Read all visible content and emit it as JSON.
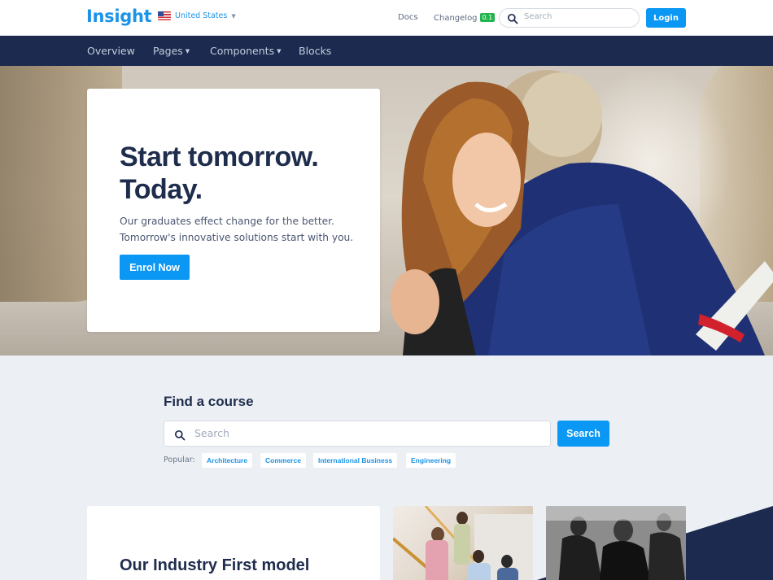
{
  "brand": {
    "logo": "Insight",
    "accent": "#1d93e8",
    "navy": "#1b2a4e"
  },
  "topbar": {
    "country": "United States",
    "docs": "Docs",
    "changelog": "Changelog",
    "changelog_badge": "0.1",
    "search_placeholder": "Search",
    "login": "Login"
  },
  "nav": {
    "items": [
      {
        "label": "Overview",
        "dropdown": false
      },
      {
        "label": "Pages",
        "dropdown": true
      },
      {
        "label": "Components",
        "dropdown": true
      },
      {
        "label": "Blocks",
        "dropdown": false
      }
    ]
  },
  "hero": {
    "title_line1": "Start tomorrow.",
    "title_line2": "Today.",
    "text_line1": "Our graduates effect change for the better.",
    "text_line2": "Tomorrow's innovative solutions start with you.",
    "cta": "Enrol Now"
  },
  "find_course": {
    "title": "Find a course",
    "search_placeholder": "Search",
    "search_button": "Search",
    "popular_label": "Popular:",
    "tags": [
      "Architecture",
      "Commerce",
      "International Business",
      "Engineering"
    ]
  },
  "model": {
    "title": "Our Industry First model"
  }
}
